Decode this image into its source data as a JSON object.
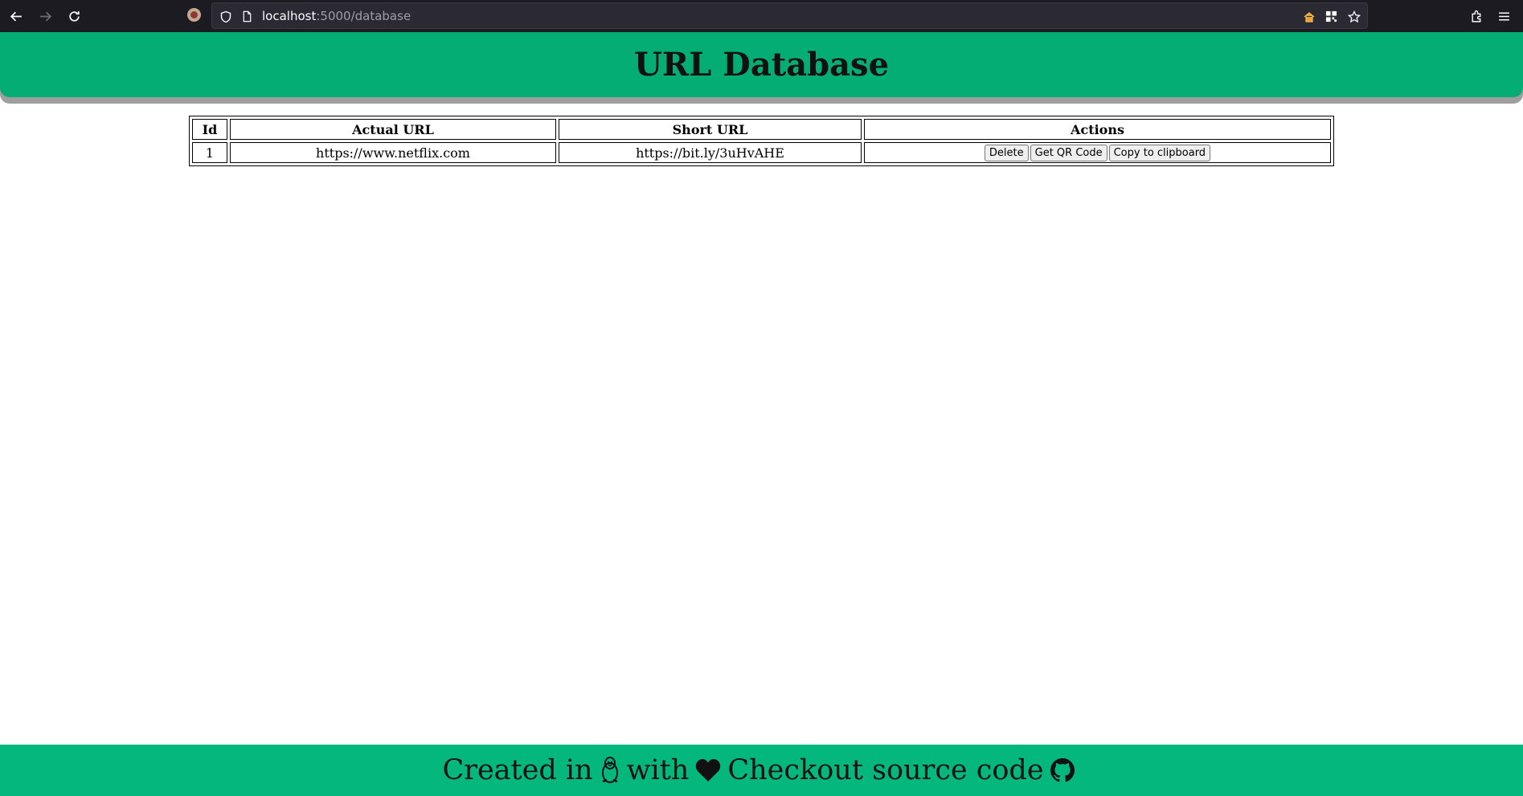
{
  "browser": {
    "url_host": "localhost",
    "url_path": ":5000/database"
  },
  "header": {
    "title": "URL Database"
  },
  "table": {
    "columns": [
      "Id",
      "Actual URL",
      "Short URL",
      "Actions"
    ],
    "rows": [
      {
        "id": "1",
        "actual_url": "https://www.netflix.com",
        "short_url": "https://bit.ly/3uHvAHE",
        "actions": [
          "Delete",
          "Get QR Code",
          "Copy to clipboard"
        ]
      }
    ]
  },
  "footer": {
    "created_in": "Created in",
    "with": "with",
    "checkout": "Checkout source code",
    "icons": [
      "linux-penguin-icon",
      "heart-icon",
      "github-icon"
    ]
  },
  "colors": {
    "header_green": "#04ad73",
    "footer_green": "#04b87d",
    "header_shadow": "#9e9e9e",
    "browser_dark": "#1c1b22"
  }
}
